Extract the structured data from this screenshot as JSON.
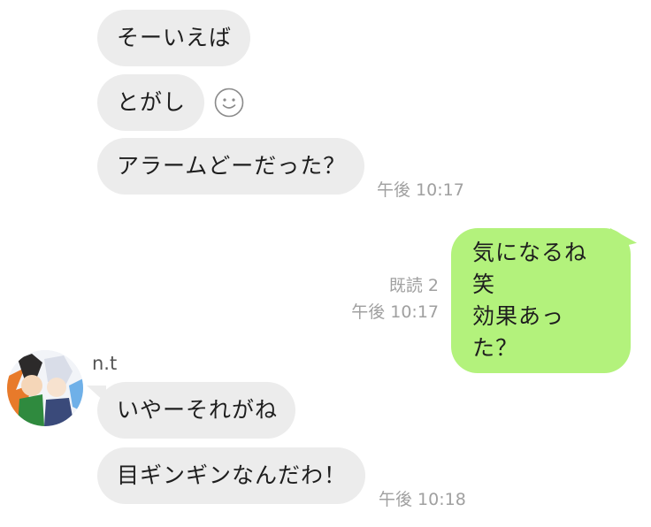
{
  "messages": [
    {
      "text": "そーいえば"
    },
    {
      "text": "とがし"
    },
    {
      "text": "アラームどーだった？",
      "time": "午後 10:17"
    },
    {
      "lines": [
        "気になるね笑",
        "効果あった？"
      ],
      "read": "既読 2",
      "time": "午後 10:17"
    },
    {
      "sender": "n.t",
      "text": "いやーそれがね"
    },
    {
      "text": "目ギンギンなんだわ！",
      "time": "午後 10:18"
    }
  ],
  "icons": {
    "reaction": "smiley-face-icon",
    "avatar": "user-avatar"
  },
  "colors": {
    "incoming_bubble": "#ececec",
    "outgoing_bubble": "#b3f27c",
    "meta_text": "#a0a0a0"
  }
}
